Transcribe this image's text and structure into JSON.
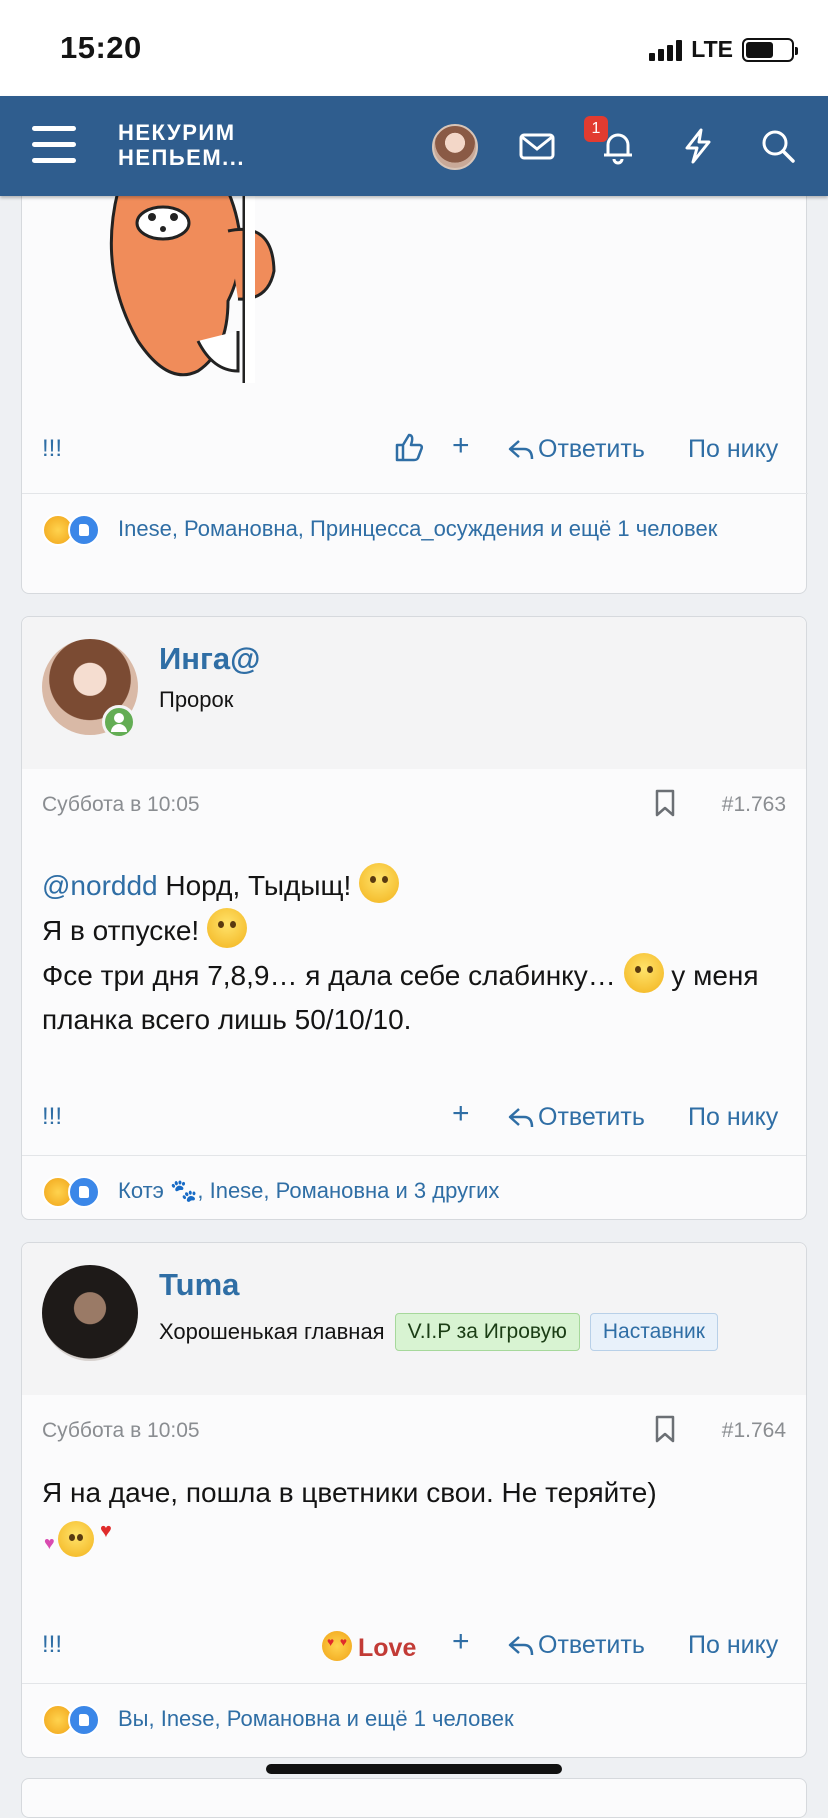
{
  "status": {
    "time": "15:20",
    "network": "LTE"
  },
  "nav": {
    "logo_line1": "НЕКУРИМ",
    "logo_line2": "НЕПЬЕМ...",
    "notification_count": "1"
  },
  "post0": {
    "report": "!!!",
    "plus": "+",
    "reply": "Ответить",
    "by_nick": "По нику",
    "reactions": "Inese, Романовна, Принцесса_осуждения и ещё 1 человек"
  },
  "post1": {
    "author": "Инга@",
    "title": "Пророк",
    "date": "Суббота в 10:05",
    "number": "#1.763",
    "mention": "@norddd",
    "line1": " Норд, Тыдыщ! ",
    "line2": "Я в отпуске! ",
    "line3": "Фсе три дня 7,8,9… я дала себе слабинку… ",
    "line3b": " у меня планка всего лишь 50/10/10.",
    "report": "!!!",
    "plus": "+",
    "reply": "Ответить",
    "by_nick": "По нику",
    "reactions": "Котэ 🐾, Inese, Романовна и 3 других"
  },
  "post2": {
    "author": "Tuma",
    "title": "Хорошенькая главная",
    "tag1": "V.I.P за Игровую",
    "tag2": "Наставник",
    "date": "Суббота в 10:05",
    "number": "#1.764",
    "text": "Я на даче, пошла в цветники свои. Не теряйте)",
    "report": "!!!",
    "love": "Love",
    "plus": "+",
    "reply": "Ответить",
    "by_nick": "По нику",
    "reactions": "Вы, Inese, Романовна и ещё 1 человек"
  },
  "colors": {
    "nav": "#2f5d8e",
    "link": "#2f6ea5",
    "love": "#c23b36"
  }
}
